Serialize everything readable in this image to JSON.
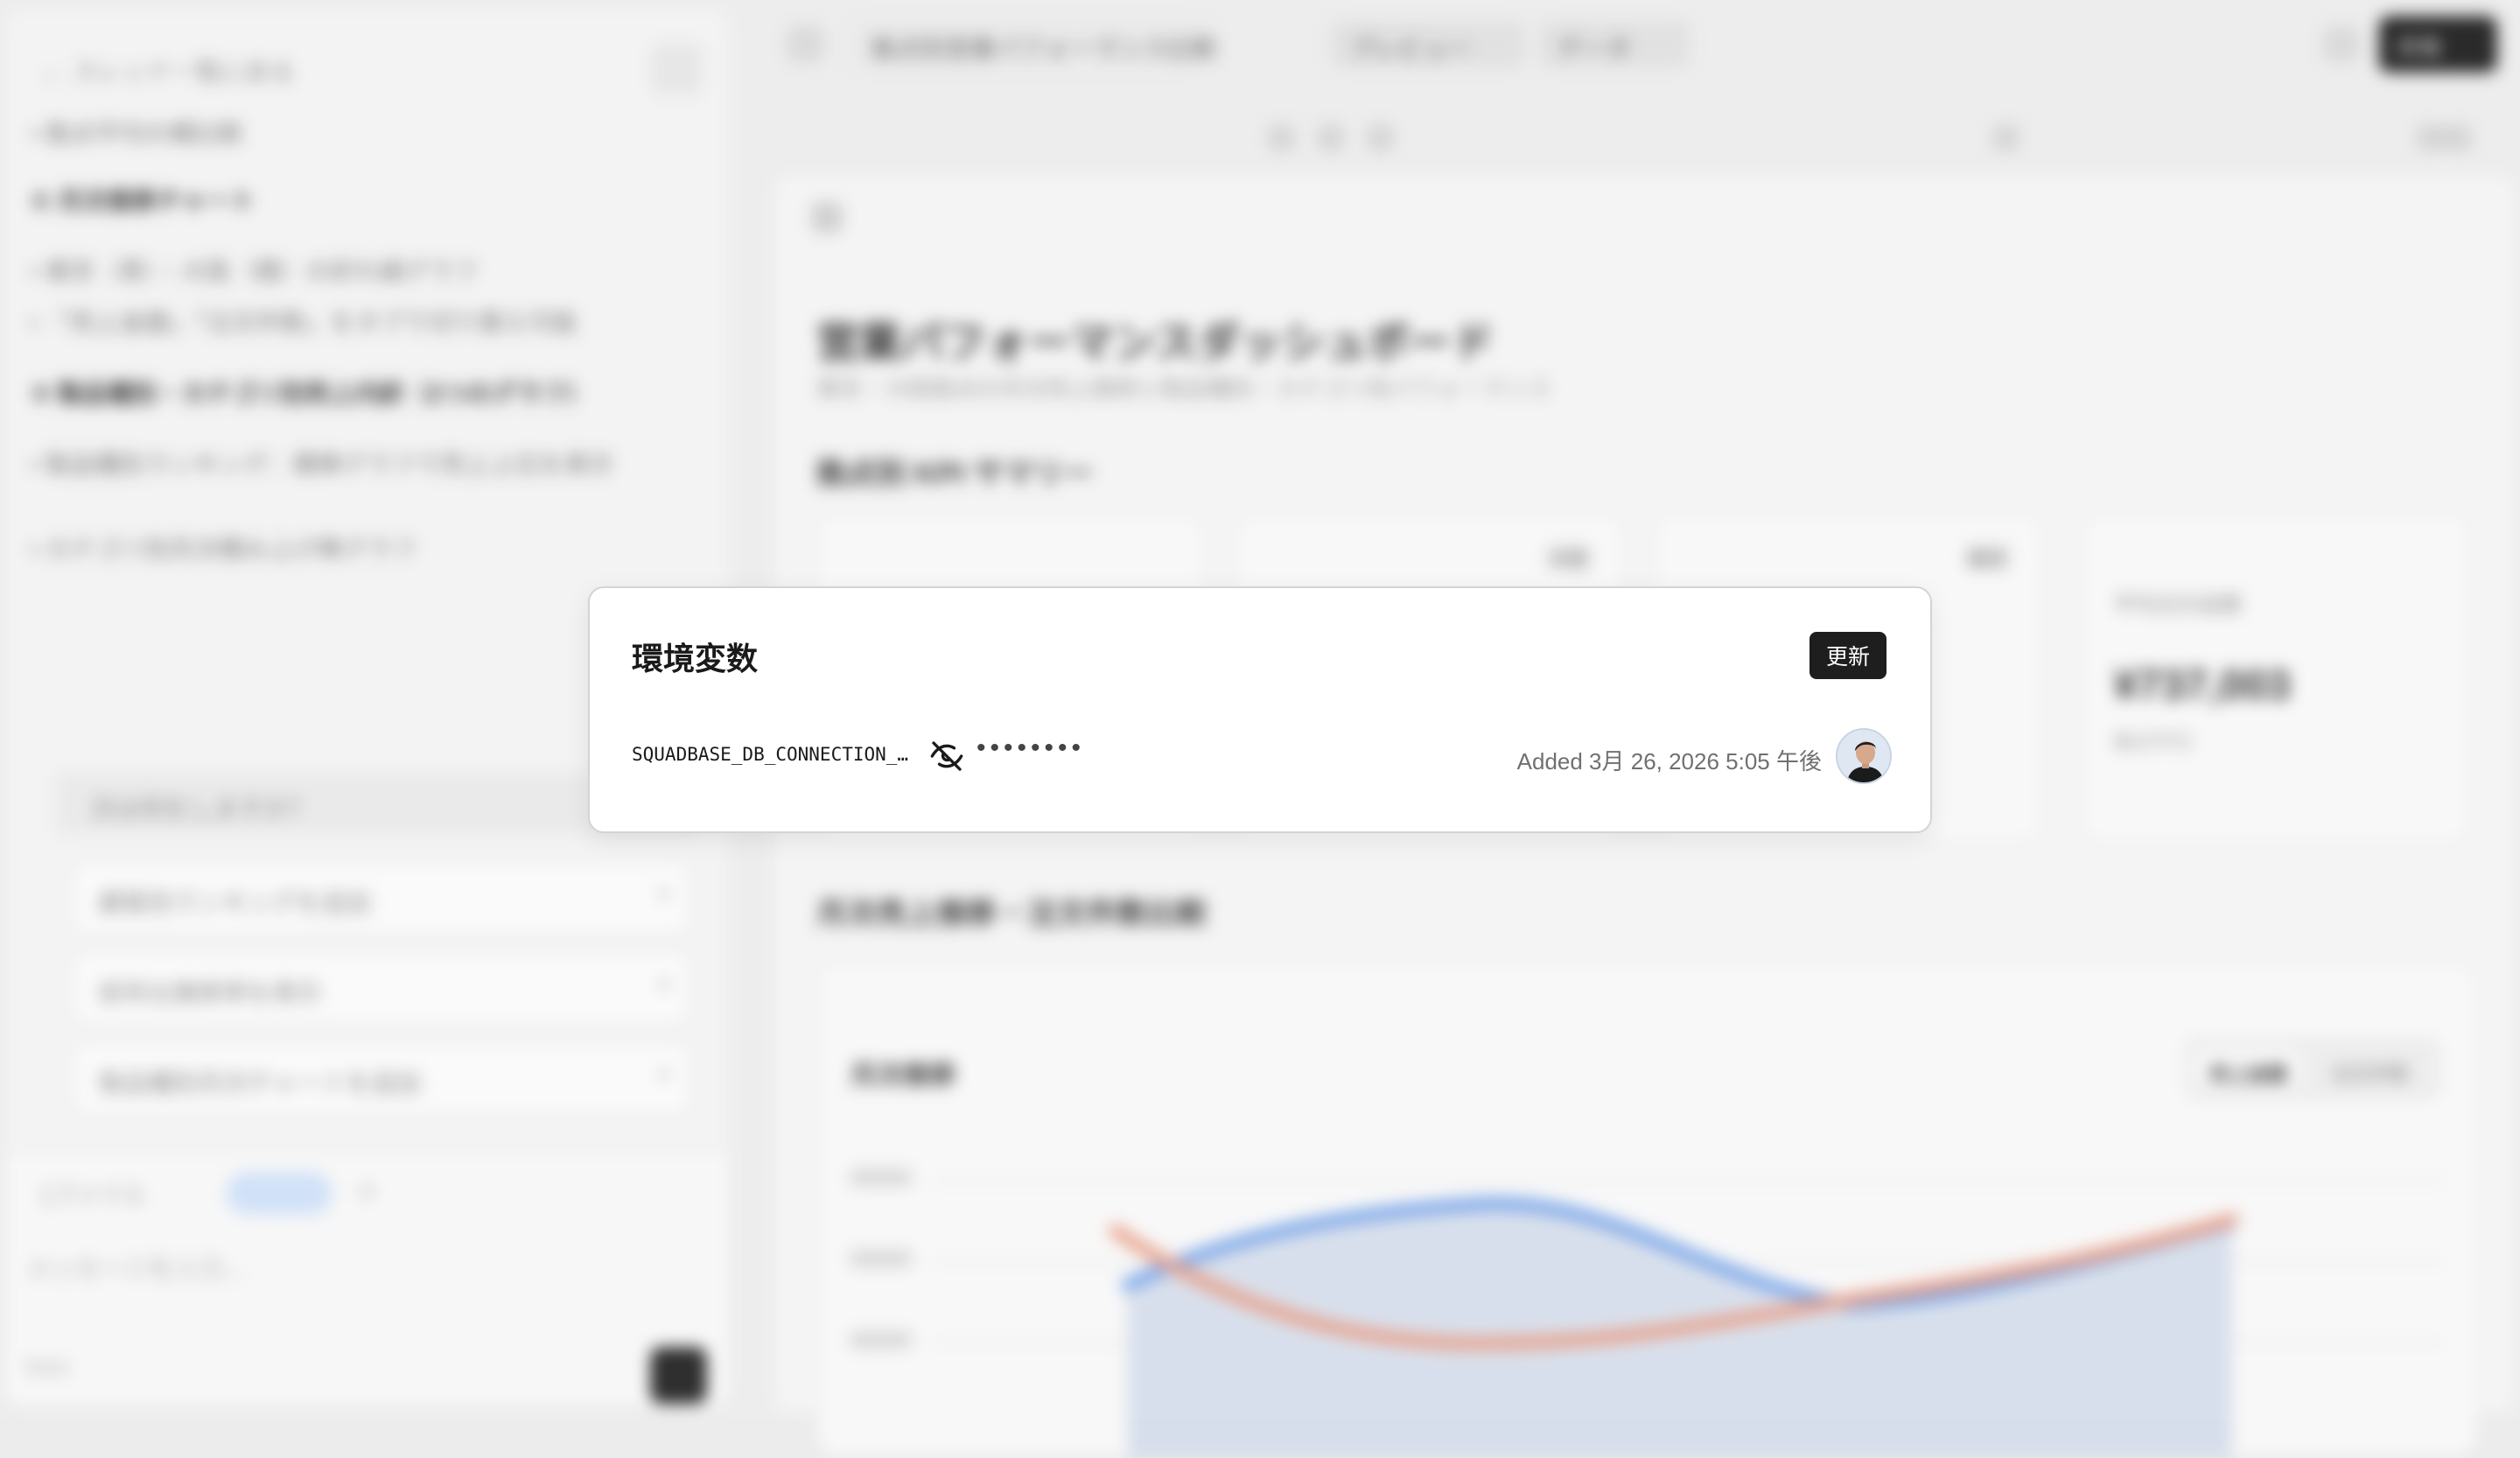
{
  "modal": {
    "title": "環境変数",
    "update_label": "更新",
    "env_var": {
      "name": "SQUADBASE_DB_CONNECTION_…",
      "masked_value": "••••••••",
      "added": "Added 3月 26, 2026 5:05 午後"
    }
  },
  "background": {
    "chat": {
      "back": "← スレッド一覧に戻る",
      "lines": [
        "• 拠点平均の横比較",
        "② 月次推移チャート",
        "• 東京（青）・大阪（橙）の折れ線グラフ",
        "• 「売上金額」「注文件数」をタブで切り替え可能",
        "③ 製品種別・カテゴリ別売上内訳（2つのグラフ）",
        "• 製品種別ランキング：横棒グラフで売上上位を表示",
        "• カテゴリ別月次積み上げ棒グラフ"
      ],
      "suggest_title": "次は何をしますか？",
      "suggestions": [
        "顧客別ランキングを追加",
        "前年比推移率を表示",
        "製品種別月次チャートを追加"
      ],
      "attach": "1ファイル",
      "input_placeholder": "メッセージを入力...",
      "model": "Kimi"
    },
    "topbar": {
      "tab_dashboard": "拠点別営業パフォーマンス比較",
      "tab_preview": "プレビュー",
      "tab_data": "データ",
      "share": "共有"
    },
    "dashboard": {
      "title": "営業パフォーマンスダッシュボード",
      "subtitle": "東京・大阪拠点の月次売上推移と製品種別・カテゴリ別パフォーマンス",
      "kpi_section": "拠点別 KPI サマリー",
      "kpi_badges": [
        "大阪",
        "東京"
      ],
      "kpi_label": "平均注文金額",
      "kpi_value": "¥737,003",
      "kpi_sub": "拠点平均",
      "trend_section": "月次売上推移・注文件数比較",
      "chart_title": "月次推移",
      "seg_on": "売上金額",
      "seg_off": "注文件数"
    }
  },
  "colors": {
    "tokyo": "#6f9fe8",
    "osaka": "#e89a82",
    "button_dark": "#1e1e1e"
  },
  "icons": {
    "eye": "eye-off-icon",
    "avatar": "user-avatar"
  }
}
